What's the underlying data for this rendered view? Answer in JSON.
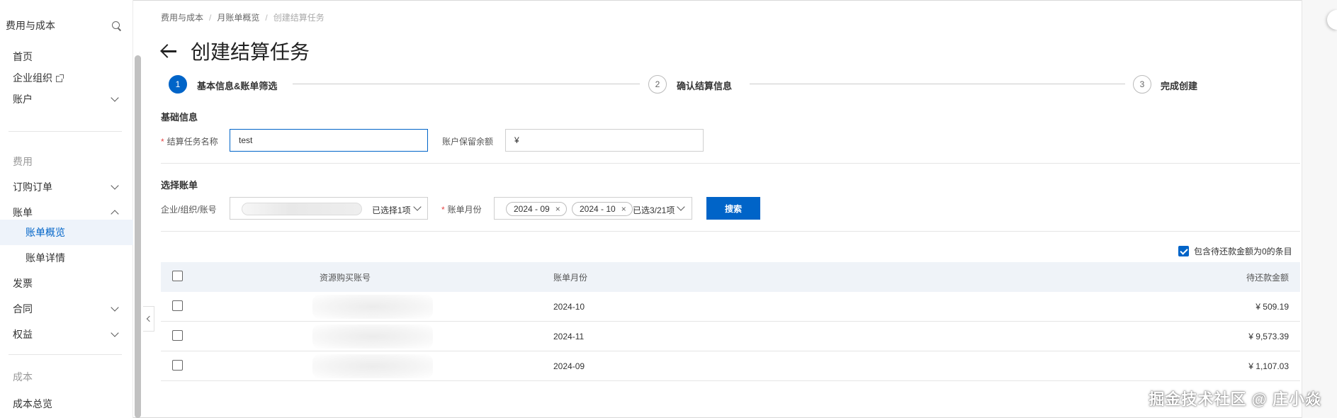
{
  "sidebar": {
    "header": "费用与成本",
    "items": [
      {
        "label": "首页"
      },
      {
        "label": "企业组织"
      },
      {
        "label": "账户"
      },
      {
        "label": "费用"
      },
      {
        "label": "订购订单"
      },
      {
        "label": "账单"
      },
      {
        "label": "账单概览"
      },
      {
        "label": "账单详情"
      },
      {
        "label": "发票"
      },
      {
        "label": "合同"
      },
      {
        "label": "权益"
      },
      {
        "label": "成本"
      },
      {
        "label": "成本总览"
      }
    ]
  },
  "breadcrumb": [
    "费用与成本",
    "月账单概览",
    "创建结算任务"
  ],
  "breadcrumb_sep": "/",
  "page_title": "创建结算任务",
  "steps": [
    {
      "num": "1",
      "label": "基本信息&账单筛选"
    },
    {
      "num": "2",
      "label": "确认结算信息"
    },
    {
      "num": "3",
      "label": "完成创建"
    }
  ],
  "basic": {
    "section_title": "基础信息",
    "required_mark": "*",
    "task_name_label": "结算任务名称",
    "task_name_value": "test",
    "reserve_label": "账户保留余额",
    "reserve_prefix": "¥"
  },
  "select_bill": {
    "section_title": "选择账单",
    "org_label": "企业/组织/账号",
    "org_selected": "已选择1项",
    "month_label": "账单月份",
    "month_tags": [
      "2024 - 09",
      "2024 - 10"
    ],
    "tag_close": "×",
    "month_count": "已选3/21项",
    "search_button": "搜索"
  },
  "include_zero_label": "包含待还款金额为0的条目",
  "include_zero_checked": true,
  "table": {
    "columns": [
      "资源购买账号",
      "账单月份",
      "待还款金额"
    ],
    "rows": [
      {
        "month": "2024-10",
        "amount": "¥ 509.19"
      },
      {
        "month": "2024-11",
        "amount": "¥ 9,573.39"
      },
      {
        "month": "2024-09",
        "amount": "¥ 1,107.03"
      }
    ]
  },
  "watermark": "掘金技术社区 @ 庄小焱",
  "colors": {
    "primary": "#0064c8",
    "header_bg": "#eff3f8",
    "active_bg": "#eef3fa"
  }
}
